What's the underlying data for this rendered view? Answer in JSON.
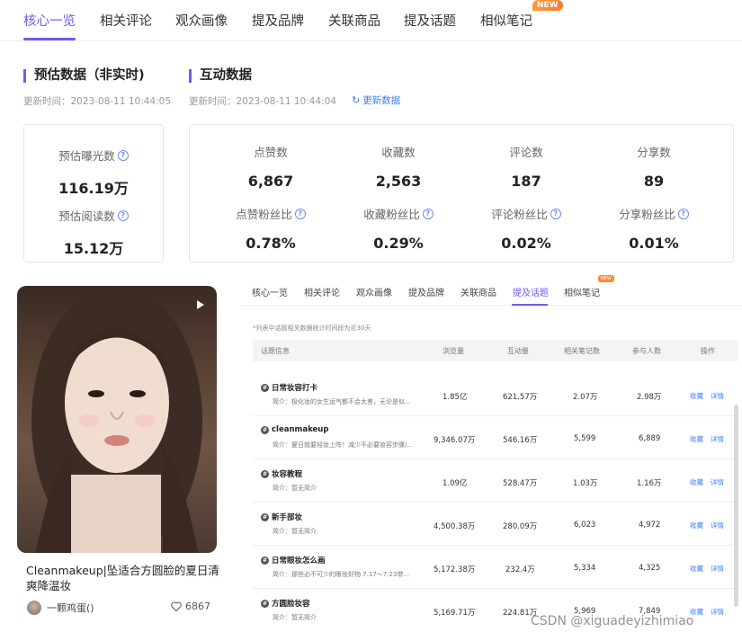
{
  "top_tabs": [
    {
      "label": "核心一览"
    },
    {
      "label": "相关评论"
    },
    {
      "label": "观众画像"
    },
    {
      "label": "提及品牌"
    },
    {
      "label": "关联商品"
    },
    {
      "label": "提及话题"
    },
    {
      "label": "相似笔记"
    }
  ],
  "new_badge": "NEW",
  "estimated": {
    "title": "预估数据（非实时)",
    "updated": "更新时间：2023-08-11 10:44:05",
    "exposure_label": "预估曝光数",
    "exposure_value": "116.19万",
    "read_label": "预估阅读数",
    "read_value": "15.12万"
  },
  "interaction": {
    "title": "互动数据",
    "updated": "更新时间：2023-08-11 10:44:04",
    "refresh_label": "更新数据",
    "metrics": [
      {
        "label": "点赞数",
        "value": "6,867"
      },
      {
        "label": "收藏数",
        "value": "2,563"
      },
      {
        "label": "评论数",
        "value": "187"
      },
      {
        "label": "分享数",
        "value": "89"
      }
    ],
    "ratios": [
      {
        "label": "点赞粉丝比",
        "value": "0.78%"
      },
      {
        "label": "收藏粉丝比",
        "value": "0.29%"
      },
      {
        "label": "评论粉丝比",
        "value": "0.02%"
      },
      {
        "label": "分享粉丝比",
        "value": "0.01%"
      }
    ]
  },
  "note": {
    "title": "Cleanmakeup|坠适合方圆脸的夏日清爽降温妆",
    "author": "一颗鸡蛋()",
    "likes": "6867"
  },
  "sub_tabs": [
    {
      "label": "核心一览"
    },
    {
      "label": "相关评论"
    },
    {
      "label": "观众画像"
    },
    {
      "label": "提及品牌"
    },
    {
      "label": "关联商品"
    },
    {
      "label": "提及话题"
    },
    {
      "label": "相似笔记"
    }
  ],
  "sub_new_badge": "NEW",
  "table_note": "*列表中话题相关数据统计时间段为近30天",
  "table": {
    "headers": {
      "topic": "话题信息",
      "views": "浏览量",
      "interactions": "互动量",
      "notes": "相关笔记数",
      "participants": "参与人数",
      "action": "操作"
    },
    "action_favorite": "收藏",
    "action_detail": "详情",
    "rows": [
      {
        "name": "日常妆容打卡",
        "desc": "简介：极化妆的女生运气都不会太差，无论是似...",
        "views": "1.85亿",
        "interactions": "621.57万",
        "notes": "2.07万",
        "participants": "2.98万"
      },
      {
        "name": "cleanmakeup",
        "desc": "简介：夏日就要轻妆上阵！减少不必要妆容步骤/...",
        "views": "9,346.07万",
        "interactions": "546.16万",
        "notes": "5,599",
        "participants": "6,889"
      },
      {
        "name": "妆容教程",
        "desc": "简介：暂无简介",
        "views": "1.09亿",
        "interactions": "528.47万",
        "notes": "1.03万",
        "participants": "1.16万"
      },
      {
        "name": "新手部妆",
        "desc": "简介：暂无简介",
        "views": "4,500.38万",
        "interactions": "280.09万",
        "notes": "6,023",
        "participants": "4,972"
      },
      {
        "name": "日常眼妆怎么画",
        "desc": "简介：那些必不可少的眼妆好物 7.17～7.23带...",
        "views": "5,172.38万",
        "interactions": "232.4万",
        "notes": "5,334",
        "participants": "4,325"
      },
      {
        "name": "方圆脸妆容",
        "desc": "简介：暂无简介",
        "views": "5,169.71万",
        "interactions": "224.81万",
        "notes": "5,969",
        "participants": "7,849"
      }
    ]
  },
  "watermark": "CSDN @xiguadeyizhimiao",
  "colors": {
    "accent": "#6e5bf5",
    "link": "#3a7bff",
    "badge": "#ff8a33"
  }
}
